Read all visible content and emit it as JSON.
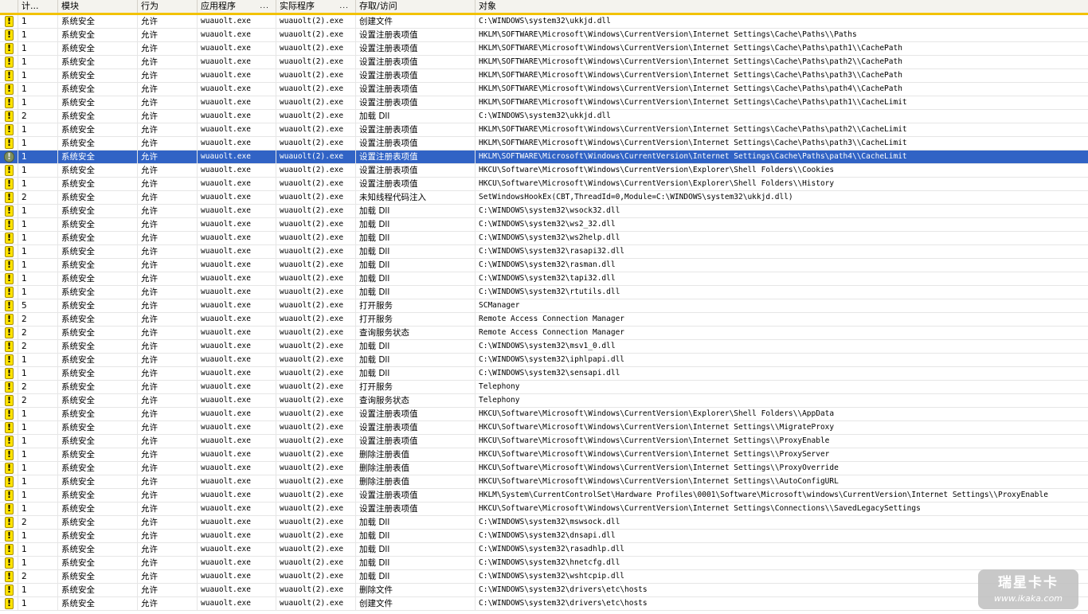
{
  "columns": {
    "count": "计...",
    "module": "模块",
    "action": "行为",
    "app": "应用程序",
    "app_more": "...",
    "actual": "实际程序",
    "actual_more": "...",
    "access": "存取/访问",
    "object": "对象"
  },
  "selected_row_index": 10,
  "rows": [
    {
      "count": "1",
      "module": "系统安全",
      "action": "允许",
      "app": "wuauolt.exe",
      "actual": "wuauolt(2).exe",
      "access": "创建文件",
      "object": "C:\\WINDOWS\\system32\\ukkjd.dll"
    },
    {
      "count": "1",
      "module": "系统安全",
      "action": "允许",
      "app": "wuauolt.exe",
      "actual": "wuauolt(2).exe",
      "access": "设置注册表项值",
      "object": "HKLM\\SOFTWARE\\Microsoft\\Windows\\CurrentVersion\\Internet Settings\\Cache\\Paths\\\\Paths"
    },
    {
      "count": "1",
      "module": "系统安全",
      "action": "允许",
      "app": "wuauolt.exe",
      "actual": "wuauolt(2).exe",
      "access": "设置注册表项值",
      "object": "HKLM\\SOFTWARE\\Microsoft\\Windows\\CurrentVersion\\Internet Settings\\Cache\\Paths\\path1\\\\CachePath"
    },
    {
      "count": "1",
      "module": "系统安全",
      "action": "允许",
      "app": "wuauolt.exe",
      "actual": "wuauolt(2).exe",
      "access": "设置注册表项值",
      "object": "HKLM\\SOFTWARE\\Microsoft\\Windows\\CurrentVersion\\Internet Settings\\Cache\\Paths\\path2\\\\CachePath"
    },
    {
      "count": "1",
      "module": "系统安全",
      "action": "允许",
      "app": "wuauolt.exe",
      "actual": "wuauolt(2).exe",
      "access": "设置注册表项值",
      "object": "HKLM\\SOFTWARE\\Microsoft\\Windows\\CurrentVersion\\Internet Settings\\Cache\\Paths\\path3\\\\CachePath"
    },
    {
      "count": "1",
      "module": "系统安全",
      "action": "允许",
      "app": "wuauolt.exe",
      "actual": "wuauolt(2).exe",
      "access": "设置注册表项值",
      "object": "HKLM\\SOFTWARE\\Microsoft\\Windows\\CurrentVersion\\Internet Settings\\Cache\\Paths\\path4\\\\CachePath"
    },
    {
      "count": "1",
      "module": "系统安全",
      "action": "允许",
      "app": "wuauolt.exe",
      "actual": "wuauolt(2).exe",
      "access": "设置注册表项值",
      "object": "HKLM\\SOFTWARE\\Microsoft\\Windows\\CurrentVersion\\Internet Settings\\Cache\\Paths\\path1\\\\CacheLimit"
    },
    {
      "count": "2",
      "module": "系统安全",
      "action": "允许",
      "app": "wuauolt.exe",
      "actual": "wuauolt(2).exe",
      "access": "加载 Dll",
      "object": "C:\\WINDOWS\\system32\\ukkjd.dll"
    },
    {
      "count": "1",
      "module": "系统安全",
      "action": "允许",
      "app": "wuauolt.exe",
      "actual": "wuauolt(2).exe",
      "access": "设置注册表项值",
      "object": "HKLM\\SOFTWARE\\Microsoft\\Windows\\CurrentVersion\\Internet Settings\\Cache\\Paths\\path2\\\\CacheLimit"
    },
    {
      "count": "1",
      "module": "系统安全",
      "action": "允许",
      "app": "wuauolt.exe",
      "actual": "wuauolt(2).exe",
      "access": "设置注册表项值",
      "object": "HKLM\\SOFTWARE\\Microsoft\\Windows\\CurrentVersion\\Internet Settings\\Cache\\Paths\\path3\\\\CacheLimit"
    },
    {
      "count": "1",
      "module": "系统安全",
      "action": "允许",
      "app": "wuauolt.exe",
      "actual": "wuauolt(2).exe",
      "access": "设置注册表项值",
      "object": "HKLM\\SOFTWARE\\Microsoft\\Windows\\CurrentVersion\\Internet Settings\\Cache\\Paths\\path4\\\\CacheLimit"
    },
    {
      "count": "1",
      "module": "系统安全",
      "action": "允许",
      "app": "wuauolt.exe",
      "actual": "wuauolt(2).exe",
      "access": "设置注册表项值",
      "object": "HKCU\\Software\\Microsoft\\Windows\\CurrentVersion\\Explorer\\Shell Folders\\\\Cookies"
    },
    {
      "count": "1",
      "module": "系统安全",
      "action": "允许",
      "app": "wuauolt.exe",
      "actual": "wuauolt(2).exe",
      "access": "设置注册表项值",
      "object": "HKCU\\Software\\Microsoft\\Windows\\CurrentVersion\\Explorer\\Shell Folders\\\\History"
    },
    {
      "count": "2",
      "module": "系统安全",
      "action": "允许",
      "app": "wuauolt.exe",
      "actual": "wuauolt(2).exe",
      "access": "未知线程代码注入",
      "object": "SetWindowsHookEx(CBT,ThreadId=0,Module=C:\\WINDOWS\\system32\\ukkjd.dll)"
    },
    {
      "count": "1",
      "module": "系统安全",
      "action": "允许",
      "app": "wuauolt.exe",
      "actual": "wuauolt(2).exe",
      "access": "加载 Dll",
      "object": "C:\\WINDOWS\\system32\\wsock32.dll"
    },
    {
      "count": "1",
      "module": "系统安全",
      "action": "允许",
      "app": "wuauolt.exe",
      "actual": "wuauolt(2).exe",
      "access": "加载 Dll",
      "object": "C:\\WINDOWS\\system32\\ws2_32.dll"
    },
    {
      "count": "1",
      "module": "系统安全",
      "action": "允许",
      "app": "wuauolt.exe",
      "actual": "wuauolt(2).exe",
      "access": "加载 Dll",
      "object": "C:\\WINDOWS\\system32\\ws2help.dll"
    },
    {
      "count": "1",
      "module": "系统安全",
      "action": "允许",
      "app": "wuauolt.exe",
      "actual": "wuauolt(2).exe",
      "access": "加载 Dll",
      "object": "C:\\WINDOWS\\system32\\rasapi32.dll"
    },
    {
      "count": "1",
      "module": "系统安全",
      "action": "允许",
      "app": "wuauolt.exe",
      "actual": "wuauolt(2).exe",
      "access": "加载 Dll",
      "object": "C:\\WINDOWS\\system32\\rasman.dll"
    },
    {
      "count": "1",
      "module": "系统安全",
      "action": "允许",
      "app": "wuauolt.exe",
      "actual": "wuauolt(2).exe",
      "access": "加载 Dll",
      "object": "C:\\WINDOWS\\system32\\tapi32.dll"
    },
    {
      "count": "1",
      "module": "系统安全",
      "action": "允许",
      "app": "wuauolt.exe",
      "actual": "wuauolt(2).exe",
      "access": "加载 Dll",
      "object": "C:\\WINDOWS\\system32\\rtutils.dll"
    },
    {
      "count": "5",
      "module": "系统安全",
      "action": "允许",
      "app": "wuauolt.exe",
      "actual": "wuauolt(2).exe",
      "access": "打开服务",
      "object": "SCManager"
    },
    {
      "count": "2",
      "module": "系统安全",
      "action": "允许",
      "app": "wuauolt.exe",
      "actual": "wuauolt(2).exe",
      "access": "打开服务",
      "object": "Remote Access Connection Manager"
    },
    {
      "count": "2",
      "module": "系统安全",
      "action": "允许",
      "app": "wuauolt.exe",
      "actual": "wuauolt(2).exe",
      "access": "查询服务状态",
      "object": "Remote Access Connection Manager"
    },
    {
      "count": "2",
      "module": "系统安全",
      "action": "允许",
      "app": "wuauolt.exe",
      "actual": "wuauolt(2).exe",
      "access": "加载 Dll",
      "object": "C:\\WINDOWS\\system32\\msv1_0.dll"
    },
    {
      "count": "1",
      "module": "系统安全",
      "action": "允许",
      "app": "wuauolt.exe",
      "actual": "wuauolt(2).exe",
      "access": "加载 Dll",
      "object": "C:\\WINDOWS\\system32\\iphlpapi.dll"
    },
    {
      "count": "1",
      "module": "系统安全",
      "action": "允许",
      "app": "wuauolt.exe",
      "actual": "wuauolt(2).exe",
      "access": "加载 Dll",
      "object": "C:\\WINDOWS\\system32\\sensapi.dll"
    },
    {
      "count": "2",
      "module": "系统安全",
      "action": "允许",
      "app": "wuauolt.exe",
      "actual": "wuauolt(2).exe",
      "access": "打开服务",
      "object": "Telephony"
    },
    {
      "count": "2",
      "module": "系统安全",
      "action": "允许",
      "app": "wuauolt.exe",
      "actual": "wuauolt(2).exe",
      "access": "查询服务状态",
      "object": "Telephony"
    },
    {
      "count": "1",
      "module": "系统安全",
      "action": "允许",
      "app": "wuauolt.exe",
      "actual": "wuauolt(2).exe",
      "access": "设置注册表项值",
      "object": "HKCU\\Software\\Microsoft\\Windows\\CurrentVersion\\Explorer\\Shell Folders\\\\AppData"
    },
    {
      "count": "1",
      "module": "系统安全",
      "action": "允许",
      "app": "wuauolt.exe",
      "actual": "wuauolt(2).exe",
      "access": "设置注册表项值",
      "object": "HKCU\\Software\\Microsoft\\Windows\\CurrentVersion\\Internet Settings\\\\MigrateProxy"
    },
    {
      "count": "1",
      "module": "系统安全",
      "action": "允许",
      "app": "wuauolt.exe",
      "actual": "wuauolt(2).exe",
      "access": "设置注册表项值",
      "object": "HKCU\\Software\\Microsoft\\Windows\\CurrentVersion\\Internet Settings\\\\ProxyEnable"
    },
    {
      "count": "1",
      "module": "系统安全",
      "action": "允许",
      "app": "wuauolt.exe",
      "actual": "wuauolt(2).exe",
      "access": "删除注册表值",
      "object": "HKCU\\Software\\Microsoft\\Windows\\CurrentVersion\\Internet Settings\\\\ProxyServer"
    },
    {
      "count": "1",
      "module": "系统安全",
      "action": "允许",
      "app": "wuauolt.exe",
      "actual": "wuauolt(2).exe",
      "access": "删除注册表值",
      "object": "HKCU\\Software\\Microsoft\\Windows\\CurrentVersion\\Internet Settings\\\\ProxyOverride"
    },
    {
      "count": "1",
      "module": "系统安全",
      "action": "允许",
      "app": "wuauolt.exe",
      "actual": "wuauolt(2).exe",
      "access": "删除注册表值",
      "object": "HKCU\\Software\\Microsoft\\Windows\\CurrentVersion\\Internet Settings\\\\AutoConfigURL"
    },
    {
      "count": "1",
      "module": "系统安全",
      "action": "允许",
      "app": "wuauolt.exe",
      "actual": "wuauolt(2).exe",
      "access": "设置注册表项值",
      "object": "HKLM\\System\\CurrentControlSet\\Hardware Profiles\\0001\\Software\\Microsoft\\windows\\CurrentVersion\\Internet Settings\\\\ProxyEnable"
    },
    {
      "count": "1",
      "module": "系统安全",
      "action": "允许",
      "app": "wuauolt.exe",
      "actual": "wuauolt(2).exe",
      "access": "设置注册表项值",
      "object": "HKCU\\Software\\Microsoft\\Windows\\CurrentVersion\\Internet Settings\\Connections\\\\SavedLegacySettings"
    },
    {
      "count": "2",
      "module": "系统安全",
      "action": "允许",
      "app": "wuauolt.exe",
      "actual": "wuauolt(2).exe",
      "access": "加载 Dll",
      "object": "C:\\WINDOWS\\system32\\mswsock.dll"
    },
    {
      "count": "1",
      "module": "系统安全",
      "action": "允许",
      "app": "wuauolt.exe",
      "actual": "wuauolt(2).exe",
      "access": "加载 Dll",
      "object": "C:\\WINDOWS\\system32\\dnsapi.dll"
    },
    {
      "count": "1",
      "module": "系统安全",
      "action": "允许",
      "app": "wuauolt.exe",
      "actual": "wuauolt(2).exe",
      "access": "加载 Dll",
      "object": "C:\\WINDOWS\\system32\\rasadhlp.dll"
    },
    {
      "count": "1",
      "module": "系统安全",
      "action": "允许",
      "app": "wuauolt.exe",
      "actual": "wuauolt(2).exe",
      "access": "加载 Dll",
      "object": "C:\\WINDOWS\\system32\\hnetcfg.dll"
    },
    {
      "count": "2",
      "module": "系统安全",
      "action": "允许",
      "app": "wuauolt.exe",
      "actual": "wuauolt(2).exe",
      "access": "加载 Dll",
      "object": "C:\\WINDOWS\\system32\\wshtcpip.dll"
    },
    {
      "count": "1",
      "module": "系统安全",
      "action": "允许",
      "app": "wuauolt.exe",
      "actual": "wuauolt(2).exe",
      "access": "删除文件",
      "object": "C:\\WINDOWS\\system32\\drivers\\etc\\hosts"
    },
    {
      "count": "1",
      "module": "系统安全",
      "action": "允许",
      "app": "wuauolt.exe",
      "actual": "wuauolt(2).exe",
      "access": "创建文件",
      "object": "C:\\WINDOWS\\system32\\drivers\\etc\\hosts"
    }
  ],
  "watermark": {
    "title": "瑞星卡卡",
    "url": "www.ikaka.com"
  },
  "icons": {
    "row": "warning-icon",
    "selected_row": "info-icon"
  },
  "colors": {
    "selection": "#3163c5",
    "warning": "#ffe300",
    "header_underline": "#f2c200"
  }
}
